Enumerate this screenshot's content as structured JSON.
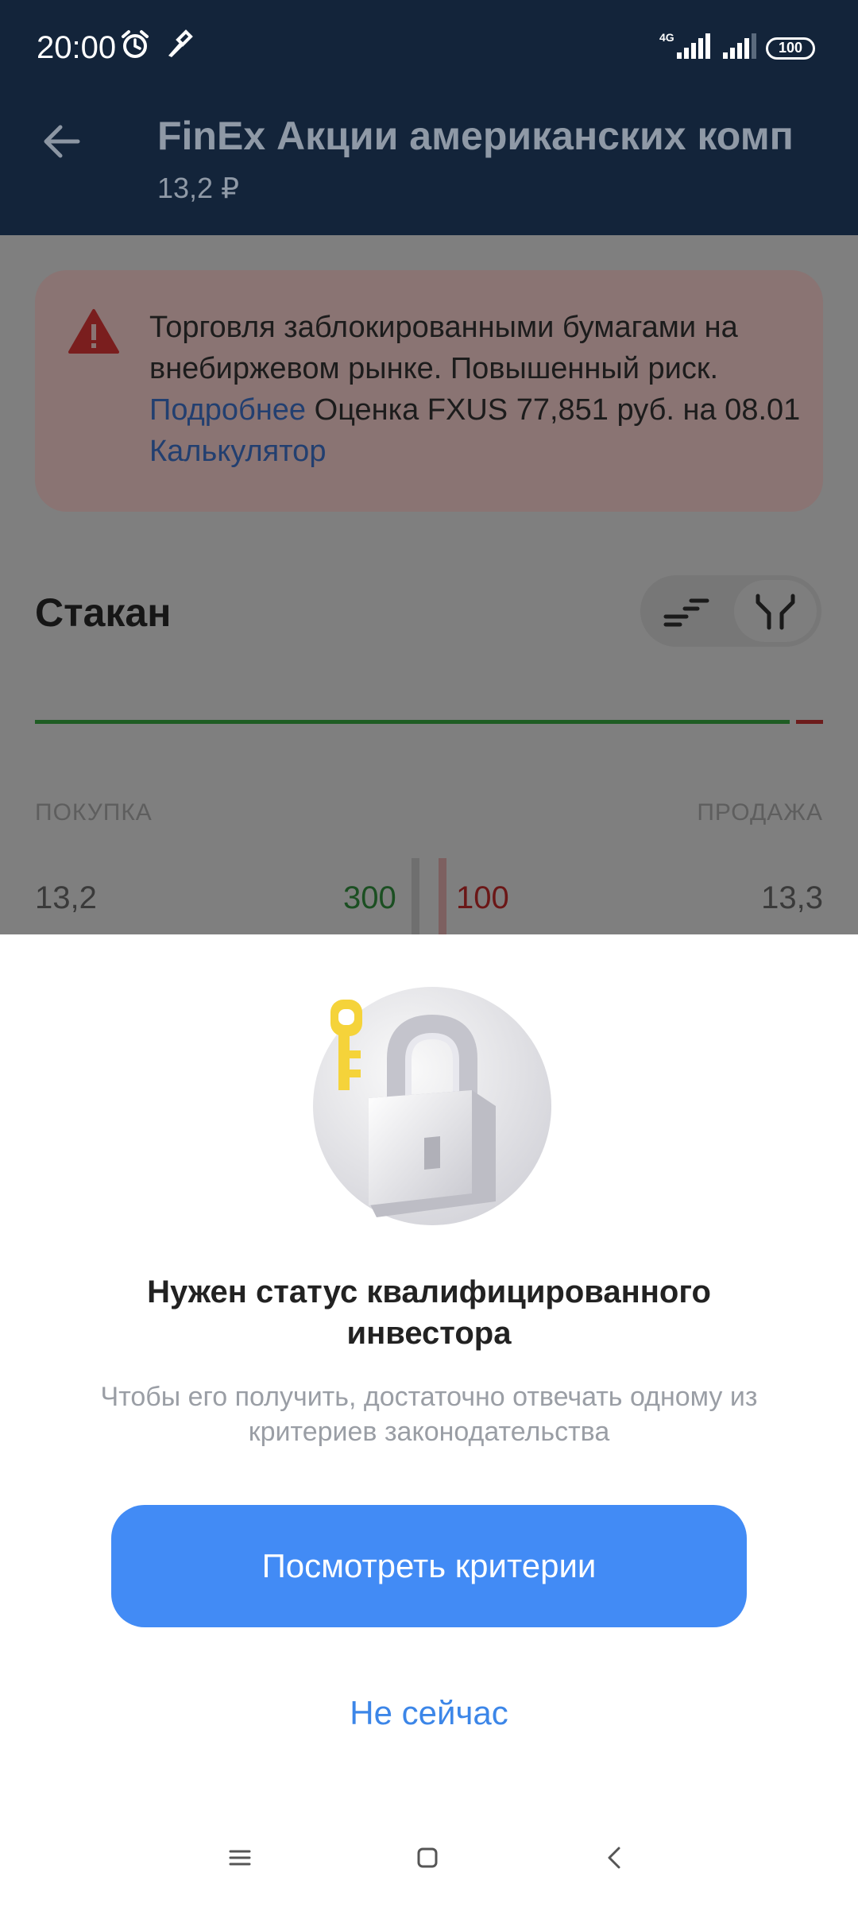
{
  "status_bar": {
    "time": "20:00",
    "network": "4G",
    "battery": "100",
    "icons": [
      "alarm-icon",
      "flashlight-icon",
      "signal-icon",
      "signal-icon",
      "battery-icon"
    ]
  },
  "app_bar": {
    "title": "FinEx Акции американских комп",
    "price": "13,2 ₽"
  },
  "warning": {
    "text_1": "Торговля заблокированными бумагами на внебиржевом рынке. Повышенный риск.",
    "link_more": "Подробнее",
    "text_2": "Оценка FXUS 77,851 руб. на 08.01",
    "link_calc": "Калькулятор"
  },
  "orderbook": {
    "title": "Стакан",
    "buy_header": "ПОКУПКА",
    "sell_header": "ПРОДАЖА",
    "row": {
      "bid_price": "13,2",
      "bid_qty": "300",
      "ask_qty": "100",
      "ask_price": "13,3"
    }
  },
  "sheet": {
    "title": "Нужен статус квалифицированного инвестора",
    "description": "Чтобы его получить, достаточно отвечать одному из критериев законодательства",
    "primary_button": "Посмотреть критерии",
    "secondary_button": "Не сейчас"
  },
  "colors": {
    "accent": "#428bf5",
    "link": "#3c86e8",
    "header_bg": "#13243a"
  }
}
